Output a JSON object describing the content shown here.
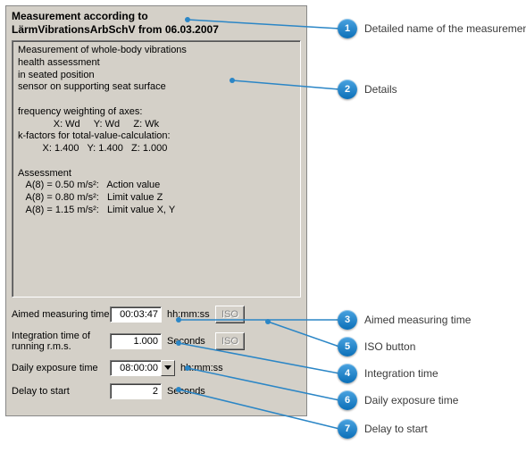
{
  "title_line1": "Measurement according to",
  "title_line2": "LärmVibrationsArbSchV from 06.03.2007",
  "details_text": "Measurement of whole-body vibrations\nhealth assessment\nin seated position\nsensor on supporting seat surface\n\nfrequency weighting of axes:\n             X: Wd     Y: Wd     Z: Wk\nk-factors for total-value-calculation:\n         X: 1.400   Y: 1.400   Z: 1.000\n\nAssessment\n   A(8) = 0.50 m/s²:   Action value\n   A(8) = 0.80 m/s²:   Limit value Z\n   A(8) = 1.15 m/s²:   Limit value X, Y",
  "aimed": {
    "label": "Aimed measuring time",
    "value": "00:03:47",
    "unit": "hh:mm:ss",
    "iso_label": "ISO"
  },
  "integration": {
    "label": "Integration time of\nrunning r.m.s.",
    "value": "1.000",
    "unit": "Seconds",
    "iso_label": "ISO"
  },
  "exposure": {
    "label": "Daily exposure time",
    "value": "08:00:00",
    "unit": "hh:mm:ss"
  },
  "delay": {
    "label": "Delay to start",
    "value": "2",
    "unit": "Seconds"
  },
  "callouts": {
    "c1": {
      "num": "1",
      "text": "Detailed name of the measurement mode"
    },
    "c2": {
      "num": "2",
      "text": "Details"
    },
    "c3": {
      "num": "3",
      "text": "Aimed measuring time"
    },
    "c4": {
      "num": "4",
      "text": "Integration time"
    },
    "c5": {
      "num": "5",
      "text": "ISO button"
    },
    "c6": {
      "num": "6",
      "text": "Daily exposure time"
    },
    "c7": {
      "num": "7",
      "text": "Delay to start"
    }
  }
}
